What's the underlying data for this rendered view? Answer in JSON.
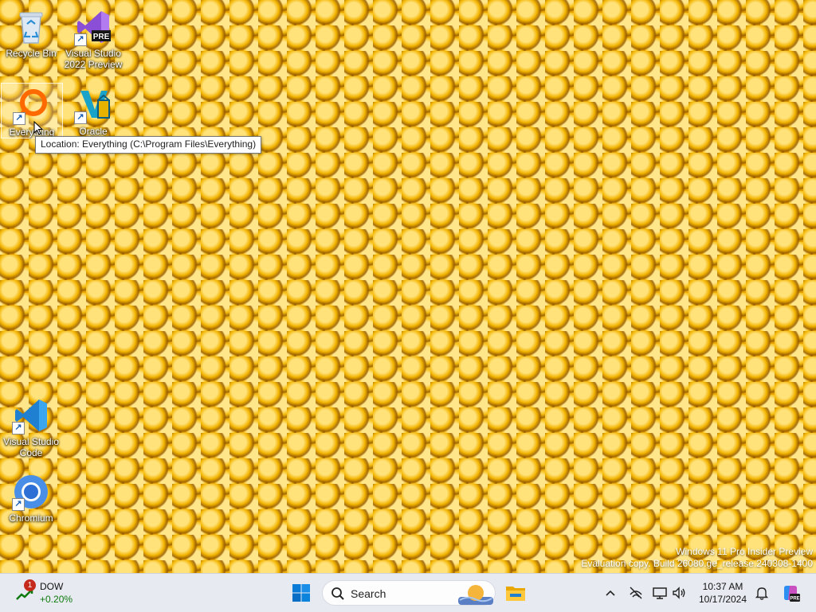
{
  "desktop": {
    "icons": [
      {
        "label": "Recycle Bin",
        "icon": "recycle-bin-icon"
      },
      {
        "label": "Visual Studio 2022 Preview",
        "icon": "visual-studio-preview-icon",
        "badge": "PRE"
      },
      {
        "label": "Everything",
        "icon": "everything-search-icon"
      },
      {
        "label": "Oracle",
        "icon": "oracle-virtualbox-icon"
      },
      {
        "label": "Visual Studio Code",
        "icon": "vscode-icon"
      },
      {
        "label": "Chromium",
        "icon": "chromium-icon"
      }
    ],
    "tooltip": "Location: Everything (C:\\Program Files\\Everything)",
    "watermark": {
      "line1": "Windows 11 Pro Insider Preview",
      "line2": "Evaluation copy. Build 26080.ge_release.240308-1400"
    }
  },
  "taskbar": {
    "widget": {
      "badge": "1",
      "ticker": "DOW",
      "change": "+0.20%"
    },
    "search": {
      "label": "Search"
    },
    "clock": {
      "time": "10:37 AM",
      "date": "10/17/2024"
    }
  },
  "colors": {
    "taskbar_bg": "#e8eaf2",
    "accent_blue": "#0078d4",
    "positive_green": "#0e7a0d",
    "badge_red": "#c42b1c"
  }
}
